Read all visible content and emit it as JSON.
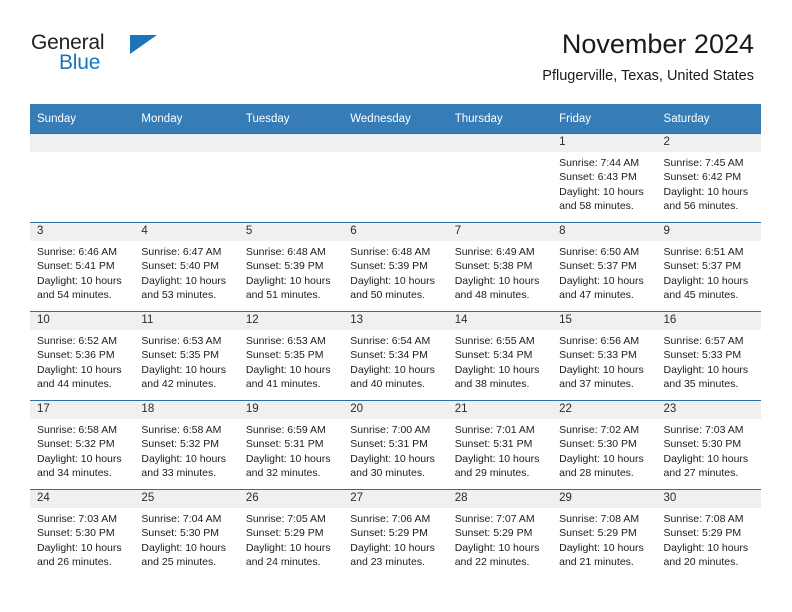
{
  "brand": {
    "name_part1": "General",
    "name_part2": "Blue",
    "triangle_color": "#1b75bb",
    "text_color": "#231f20"
  },
  "header": {
    "title": "November 2024",
    "subtitle": "Pflugerville, Texas, United States"
  },
  "theme": {
    "header_row_bg": "#367cb7",
    "header_row_text": "#ffffff",
    "daynum_strip_bg": "#f0f0f0",
    "row_divider": "#2f6ea5",
    "page_bg": "#ffffff"
  },
  "weekday_headers": [
    "Sunday",
    "Monday",
    "Tuesday",
    "Wednesday",
    "Thursday",
    "Friday",
    "Saturday"
  ],
  "labels": {
    "sunrise_prefix": "Sunrise:",
    "sunset_prefix": "Sunset:",
    "daylight_prefix": "Daylight:"
  },
  "weeks": [
    [
      {
        "blank": true
      },
      {
        "blank": true
      },
      {
        "blank": true
      },
      {
        "blank": true
      },
      {
        "blank": true
      },
      {
        "blank": false,
        "day": "1",
        "sunrise": "Sunrise: 7:44 AM",
        "sunset": "Sunset: 6:43 PM",
        "daylight_line1": "Daylight: 10 hours",
        "daylight_line2": "and 58 minutes."
      },
      {
        "blank": false,
        "day": "2",
        "sunrise": "Sunrise: 7:45 AM",
        "sunset": "Sunset: 6:42 PM",
        "daylight_line1": "Daylight: 10 hours",
        "daylight_line2": "and 56 minutes."
      }
    ],
    [
      {
        "blank": false,
        "day": "3",
        "sunrise": "Sunrise: 6:46 AM",
        "sunset": "Sunset: 5:41 PM",
        "daylight_line1": "Daylight: 10 hours",
        "daylight_line2": "and 54 minutes."
      },
      {
        "blank": false,
        "day": "4",
        "sunrise": "Sunrise: 6:47 AM",
        "sunset": "Sunset: 5:40 PM",
        "daylight_line1": "Daylight: 10 hours",
        "daylight_line2": "and 53 minutes."
      },
      {
        "blank": false,
        "day": "5",
        "sunrise": "Sunrise: 6:48 AM",
        "sunset": "Sunset: 5:39 PM",
        "daylight_line1": "Daylight: 10 hours",
        "daylight_line2": "and 51 minutes."
      },
      {
        "blank": false,
        "day": "6",
        "sunrise": "Sunrise: 6:48 AM",
        "sunset": "Sunset: 5:39 PM",
        "daylight_line1": "Daylight: 10 hours",
        "daylight_line2": "and 50 minutes."
      },
      {
        "blank": false,
        "day": "7",
        "sunrise": "Sunrise: 6:49 AM",
        "sunset": "Sunset: 5:38 PM",
        "daylight_line1": "Daylight: 10 hours",
        "daylight_line2": "and 48 minutes."
      },
      {
        "blank": false,
        "day": "8",
        "sunrise": "Sunrise: 6:50 AM",
        "sunset": "Sunset: 5:37 PM",
        "daylight_line1": "Daylight: 10 hours",
        "daylight_line2": "and 47 minutes."
      },
      {
        "blank": false,
        "day": "9",
        "sunrise": "Sunrise: 6:51 AM",
        "sunset": "Sunset: 5:37 PM",
        "daylight_line1": "Daylight: 10 hours",
        "daylight_line2": "and 45 minutes."
      }
    ],
    [
      {
        "blank": false,
        "day": "10",
        "sunrise": "Sunrise: 6:52 AM",
        "sunset": "Sunset: 5:36 PM",
        "daylight_line1": "Daylight: 10 hours",
        "daylight_line2": "and 44 minutes."
      },
      {
        "blank": false,
        "day": "11",
        "sunrise": "Sunrise: 6:53 AM",
        "sunset": "Sunset: 5:35 PM",
        "daylight_line1": "Daylight: 10 hours",
        "daylight_line2": "and 42 minutes."
      },
      {
        "blank": false,
        "day": "12",
        "sunrise": "Sunrise: 6:53 AM",
        "sunset": "Sunset: 5:35 PM",
        "daylight_line1": "Daylight: 10 hours",
        "daylight_line2": "and 41 minutes."
      },
      {
        "blank": false,
        "day": "13",
        "sunrise": "Sunrise: 6:54 AM",
        "sunset": "Sunset: 5:34 PM",
        "daylight_line1": "Daylight: 10 hours",
        "daylight_line2": "and 40 minutes."
      },
      {
        "blank": false,
        "day": "14",
        "sunrise": "Sunrise: 6:55 AM",
        "sunset": "Sunset: 5:34 PM",
        "daylight_line1": "Daylight: 10 hours",
        "daylight_line2": "and 38 minutes."
      },
      {
        "blank": false,
        "day": "15",
        "sunrise": "Sunrise: 6:56 AM",
        "sunset": "Sunset: 5:33 PM",
        "daylight_line1": "Daylight: 10 hours",
        "daylight_line2": "and 37 minutes."
      },
      {
        "blank": false,
        "day": "16",
        "sunrise": "Sunrise: 6:57 AM",
        "sunset": "Sunset: 5:33 PM",
        "daylight_line1": "Daylight: 10 hours",
        "daylight_line2": "and 35 minutes."
      }
    ],
    [
      {
        "blank": false,
        "day": "17",
        "sunrise": "Sunrise: 6:58 AM",
        "sunset": "Sunset: 5:32 PM",
        "daylight_line1": "Daylight: 10 hours",
        "daylight_line2": "and 34 minutes."
      },
      {
        "blank": false,
        "day": "18",
        "sunrise": "Sunrise: 6:58 AM",
        "sunset": "Sunset: 5:32 PM",
        "daylight_line1": "Daylight: 10 hours",
        "daylight_line2": "and 33 minutes."
      },
      {
        "blank": false,
        "day": "19",
        "sunrise": "Sunrise: 6:59 AM",
        "sunset": "Sunset: 5:31 PM",
        "daylight_line1": "Daylight: 10 hours",
        "daylight_line2": "and 32 minutes."
      },
      {
        "blank": false,
        "day": "20",
        "sunrise": "Sunrise: 7:00 AM",
        "sunset": "Sunset: 5:31 PM",
        "daylight_line1": "Daylight: 10 hours",
        "daylight_line2": "and 30 minutes."
      },
      {
        "blank": false,
        "day": "21",
        "sunrise": "Sunrise: 7:01 AM",
        "sunset": "Sunset: 5:31 PM",
        "daylight_line1": "Daylight: 10 hours",
        "daylight_line2": "and 29 minutes."
      },
      {
        "blank": false,
        "day": "22",
        "sunrise": "Sunrise: 7:02 AM",
        "sunset": "Sunset: 5:30 PM",
        "daylight_line1": "Daylight: 10 hours",
        "daylight_line2": "and 28 minutes."
      },
      {
        "blank": false,
        "day": "23",
        "sunrise": "Sunrise: 7:03 AM",
        "sunset": "Sunset: 5:30 PM",
        "daylight_line1": "Daylight: 10 hours",
        "daylight_line2": "and 27 minutes."
      }
    ],
    [
      {
        "blank": false,
        "day": "24",
        "sunrise": "Sunrise: 7:03 AM",
        "sunset": "Sunset: 5:30 PM",
        "daylight_line1": "Daylight: 10 hours",
        "daylight_line2": "and 26 minutes."
      },
      {
        "blank": false,
        "day": "25",
        "sunrise": "Sunrise: 7:04 AM",
        "sunset": "Sunset: 5:30 PM",
        "daylight_line1": "Daylight: 10 hours",
        "daylight_line2": "and 25 minutes."
      },
      {
        "blank": false,
        "day": "26",
        "sunrise": "Sunrise: 7:05 AM",
        "sunset": "Sunset: 5:29 PM",
        "daylight_line1": "Daylight: 10 hours",
        "daylight_line2": "and 24 minutes."
      },
      {
        "blank": false,
        "day": "27",
        "sunrise": "Sunrise: 7:06 AM",
        "sunset": "Sunset: 5:29 PM",
        "daylight_line1": "Daylight: 10 hours",
        "daylight_line2": "and 23 minutes."
      },
      {
        "blank": false,
        "day": "28",
        "sunrise": "Sunrise: 7:07 AM",
        "sunset": "Sunset: 5:29 PM",
        "daylight_line1": "Daylight: 10 hours",
        "daylight_line2": "and 22 minutes."
      },
      {
        "blank": false,
        "day": "29",
        "sunrise": "Sunrise: 7:08 AM",
        "sunset": "Sunset: 5:29 PM",
        "daylight_line1": "Daylight: 10 hours",
        "daylight_line2": "and 21 minutes."
      },
      {
        "blank": false,
        "day": "30",
        "sunrise": "Sunrise: 7:08 AM",
        "sunset": "Sunset: 5:29 PM",
        "daylight_line1": "Daylight: 10 hours",
        "daylight_line2": "and 20 minutes."
      }
    ]
  ]
}
